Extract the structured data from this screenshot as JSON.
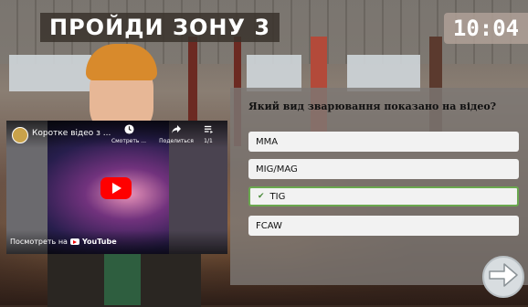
{
  "title": "ПРОЙДИ ЗОНУ 3",
  "timer": "10:04",
  "video": {
    "title": "Коротке відео з ...",
    "watch_later_label": "Смотреть ...",
    "share_label": "Поделиться",
    "playlist_count": "1/1",
    "watch_on_label": "Посмотреть на",
    "youtube_word": "YouTube"
  },
  "quiz": {
    "question": "Який вид зварювання показано на відео?",
    "options": [
      {
        "label": "MMA",
        "selected": false
      },
      {
        "label": "MIG/MAG",
        "selected": false
      },
      {
        "label": "TIG",
        "selected": true
      },
      {
        "label": "FCAW",
        "selected": false
      }
    ],
    "check_mark": "✔"
  },
  "colors": {
    "selected_border": "#6aa84f",
    "youtube_red": "#ff0000"
  },
  "icons": {
    "next": "arrow-right-icon",
    "watch_later": "clock-icon",
    "share": "share-icon",
    "playlist": "playlist-icon"
  }
}
